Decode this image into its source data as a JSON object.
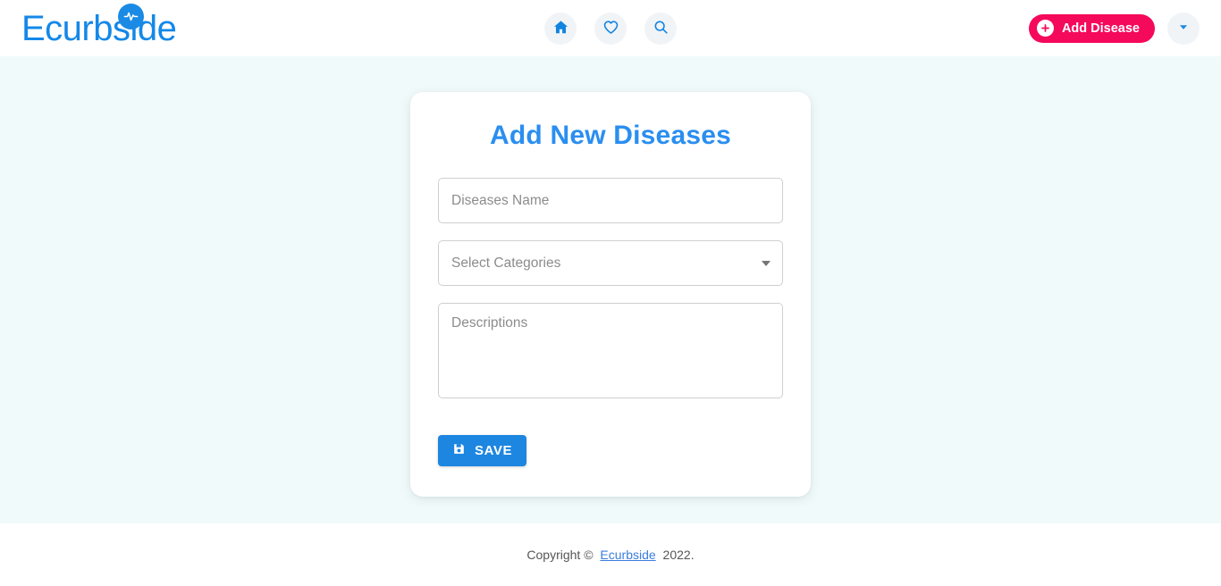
{
  "header": {
    "brand": {
      "text_before": "E",
      "text_after": "curbside",
      "full": "Ecurbside",
      "badge_icon": "pulse-icon",
      "color": "#1a8ae5"
    },
    "nav": [
      {
        "name": "home",
        "icon": "home-icon",
        "label": "Home"
      },
      {
        "name": "favorites",
        "icon": "heart-icon",
        "label": "Favorites"
      },
      {
        "name": "search",
        "icon": "search-icon",
        "label": "Search"
      }
    ],
    "add_disease": {
      "label": "Add Disease",
      "icon": "plus-circle-icon",
      "color": "#f5095a"
    },
    "account_caret": {
      "icon": "chevron-down-icon",
      "color": "#1a8ae5"
    }
  },
  "main": {
    "card": {
      "title": "Add New Diseases",
      "title_color": "#2a8ef0",
      "fields": {
        "disease_name": {
          "placeholder": "Diseases Name",
          "value": ""
        },
        "categories": {
          "placeholder": "Select Categories",
          "value": "",
          "options": [
            "Select Categories"
          ]
        },
        "descriptions": {
          "placeholder": "Descriptions",
          "value": ""
        }
      },
      "save_button": {
        "label": "SAVE",
        "icon": "save-disk-icon",
        "color": "#1c86e0"
      }
    }
  },
  "footer": {
    "prefix": "Copyright © ",
    "link": "Ecurbside",
    "suffix": " 2022."
  },
  "theme": {
    "page_background": "#f1fafa",
    "surface": "#ffffff",
    "accent_blue": "#1a8ae5",
    "accent_pink": "#f5095a",
    "border_gray": "#cfcfcf",
    "placeholder_gray": "#8c8c8c"
  }
}
